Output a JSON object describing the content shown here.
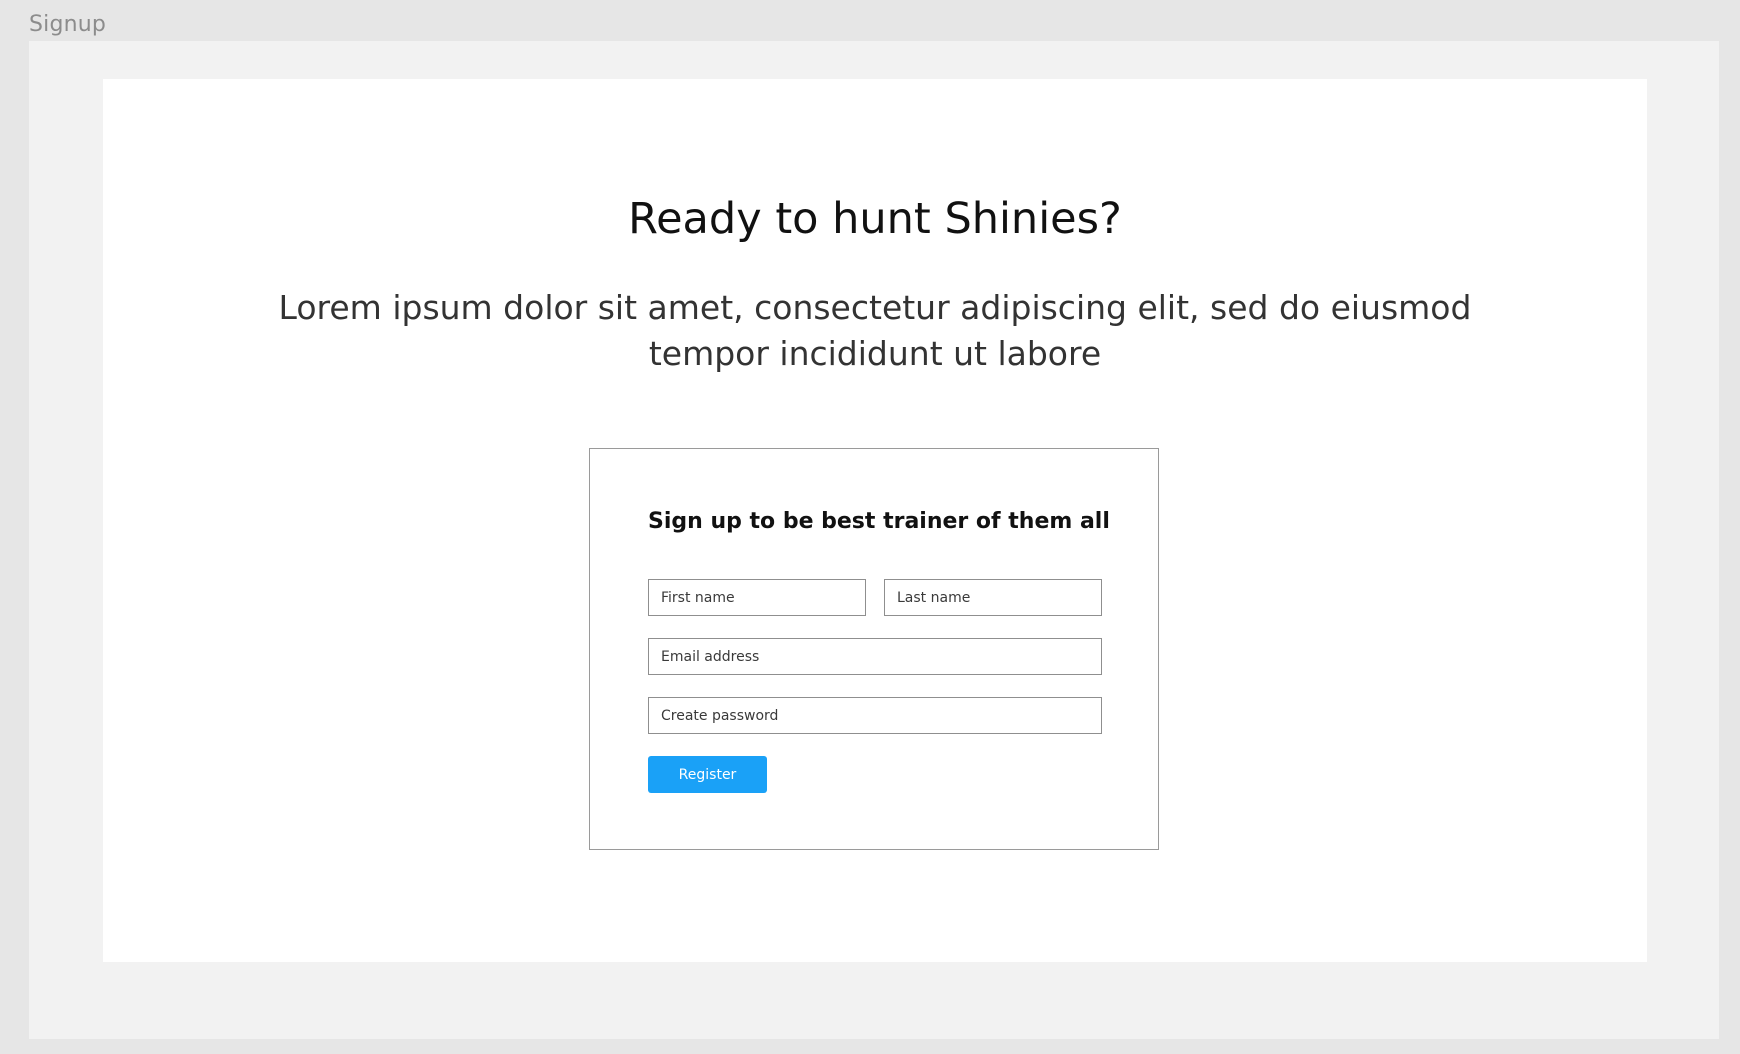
{
  "frame": {
    "label": "Signup"
  },
  "hero": {
    "title": "Ready to hunt Shinies?",
    "description": "Lorem ipsum dolor sit amet, consectetur adipiscing elit, sed do eiusmod tempor incididunt ut labore"
  },
  "signup_form": {
    "title": "Sign up to be best trainer of them all",
    "first_name": {
      "placeholder": "First name",
      "value": ""
    },
    "last_name": {
      "placeholder": "Last name",
      "value": ""
    },
    "email": {
      "placeholder": "Email address",
      "value": ""
    },
    "password": {
      "placeholder": "Create password",
      "value": ""
    },
    "register_label": "Register"
  },
  "colors": {
    "canvas_background": "#e6e6e6",
    "frame_background": "#f2f2f2",
    "page_background": "#ffffff",
    "button_accent": "#1aa1f7",
    "field_border": "#8f8f8f"
  }
}
